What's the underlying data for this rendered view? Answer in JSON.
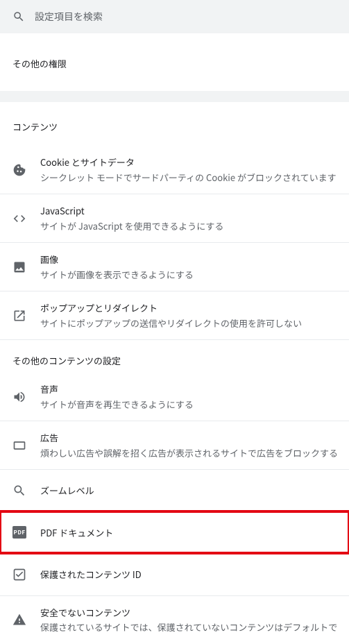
{
  "search": {
    "placeholder": "設定項目を検索"
  },
  "group1": {
    "title": "その他の権限"
  },
  "content": {
    "title": "コンテンツ",
    "cookies": {
      "title": "Cookie とサイトデータ",
      "sub": "シークレット モードでサードパーティの Cookie がブロックされています"
    },
    "javascript": {
      "title": "JavaScript",
      "sub": "サイトが JavaScript を使用できるようにする"
    },
    "images": {
      "title": "画像",
      "sub": "サイトが画像を表示できるようにする"
    },
    "popups": {
      "title": "ポップアップとリダイレクト",
      "sub": "サイトにポップアップの送信やリダイレクトの使用を許可しない"
    }
  },
  "other": {
    "title": "その他のコンテンツの設定",
    "sound": {
      "title": "音声",
      "sub": "サイトが音声を再生できるようにする"
    },
    "ads": {
      "title": "広告",
      "sub": "煩わしい広告や誤解を招く広告が表示されるサイトで広告をブロックする"
    },
    "zoom": {
      "title": "ズームレベル"
    },
    "pdf": {
      "title": "PDF ドキュメント",
      "badge": "PDF"
    },
    "protected": {
      "title": "保護されたコンテンツ ID"
    },
    "insecure": {
      "title": "安全でないコンテンツ",
      "sub": "保護されているサイトでは、保護されていないコンテンツはデフォルトでブ"
    }
  }
}
